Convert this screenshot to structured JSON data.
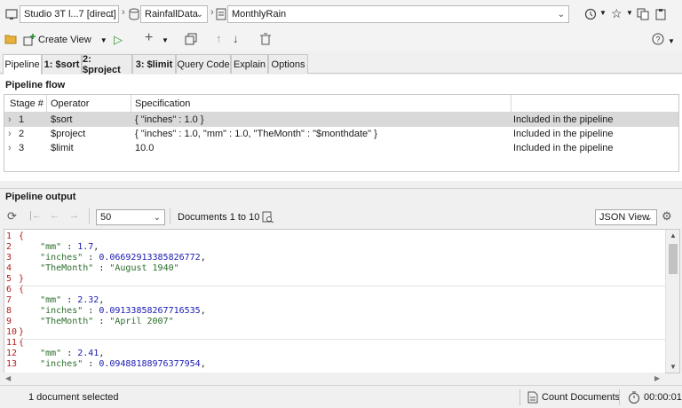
{
  "breadcrumb": {
    "connection": "Studio 3T l...7 [direct]",
    "database": "RainfallData",
    "collection": "MonthlyRain"
  },
  "toolbar": {
    "open_label": "",
    "add_view_label": "Create View"
  },
  "tabs": [
    {
      "label": "Pipeline"
    },
    {
      "label": "1: $sort"
    },
    {
      "label": "2: $project"
    },
    {
      "label": "3: $limit"
    },
    {
      "label": "Query Code"
    },
    {
      "label": "Explain"
    },
    {
      "label": "Options"
    }
  ],
  "pipeline_flow": {
    "title": "Pipeline flow",
    "columns": [
      "Stage #",
      "Operator",
      "Specification",
      ""
    ],
    "rows": [
      {
        "stage": "1",
        "operator": "$sort",
        "spec": "{ \"inches\" : 1.0 }",
        "status": "Included in the pipeline"
      },
      {
        "stage": "2",
        "operator": "$project",
        "spec": "{ \"inches\" : 1.0, \"mm\" : 1.0, \"TheMonth\" : \"$monthdate\" }",
        "status": "Included in the pipeline"
      },
      {
        "stage": "3",
        "operator": "$limit",
        "spec": "10.0",
        "status": "Included in the pipeline"
      }
    ]
  },
  "pipeline_output": {
    "title": "Pipeline output",
    "page_size": "50",
    "documents_range": "Documents 1 to 10",
    "view_mode": "JSON View"
  },
  "editor_lines": [
    {
      "n": "1",
      "t": "{"
    },
    {
      "n": "2",
      "t": "    \"mm\" : 1.7,"
    },
    {
      "n": "3",
      "t": "    \"inches\" : 0.06692913385826772,"
    },
    {
      "n": "4",
      "t": "    \"TheMonth\" : \"August 1940\""
    },
    {
      "n": "5",
      "t": "}"
    },
    {
      "n": "6",
      "t": "{"
    },
    {
      "n": "7",
      "t": "    \"mm\" : 2.32,"
    },
    {
      "n": "8",
      "t": "    \"inches\" : 0.09133858267716535,"
    },
    {
      "n": "9",
      "t": "    \"TheMonth\" : \"April 2007\""
    },
    {
      "n": "10",
      "t": "}"
    },
    {
      "n": "11",
      "t": "{"
    },
    {
      "n": "12",
      "t": "    \"mm\" : 2.41,"
    },
    {
      "n": "13",
      "t": "    \"inches\" : 0.09488188976377954,"
    }
  ],
  "status": {
    "selection": "1 document selected",
    "count_label": "Count Documents",
    "timer": "00:00:01"
  }
}
